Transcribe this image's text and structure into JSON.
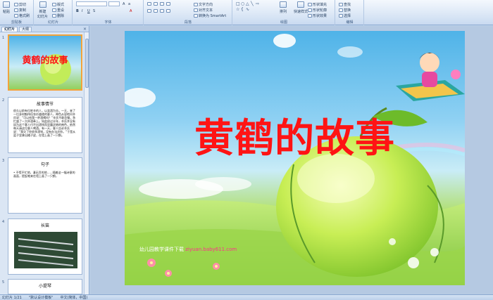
{
  "ribbon": {
    "groups": [
      "剪贴板",
      "幻灯片",
      "字体",
      "段落",
      "绘图",
      "编辑"
    ],
    "paste": "粘贴",
    "cut": "剪切",
    "copy": "复制",
    "format_painter": "格式刷",
    "new_slide": "新建\n幻灯片",
    "layout": "版式",
    "reset": "重设",
    "delete": "删除",
    "text_direction": "文字方向",
    "align_text": "对齐文本",
    "convert_smartart": "转换为 SmartArt",
    "arrange": "排列",
    "quick_styles": "快速样式",
    "shape_fill": "形状填充",
    "shape_outline": "形状轮廓",
    "shape_effects": "形状效果",
    "find": "查找",
    "replace": "替换",
    "select": "选择"
  },
  "panel": {
    "tabs": [
      "幻灯片",
      "大纲"
    ],
    "close": "×",
    "thumbnails": [
      {
        "num": "1",
        "title": "黄鹤的故事"
      },
      {
        "num": "2",
        "title": "故事情节",
        "text": "很久以前有位姓辛的人，以卖酒为业。一天，来了一位身材魁伟但衣衫褴褛的客人，神色从容地问辛氏说：“可以给我一杯酒喝吗？”辛氏不敢怠慢，急忙盛了一大杯酒奉上。如此经过半年，辛氏并没有因为这个客人付不出酒钱而显露厌倦的神色，依然每天请这位客人喝酒。有一天，客人告诉辛氏说：“我欠了你很多酒钱，没有办法还你。”于是从篮子里拿出橘子皮，在墙上画了一只鹤。"
      },
      {
        "num": "3",
        "title": "句子",
        "text": "• 不慌不忙地，漫无目的地……随着这一幅诗意的画面，提起笔来在墙上画了一只鹤，"
      },
      {
        "num": "4",
        "title": "长笛"
      },
      {
        "num": "5",
        "title": "小提琴"
      }
    ]
  },
  "slide": {
    "title": "黄鹤的故事",
    "footer_text": "幼儿园教学课件下载",
    "footer_url": "ziyuan.baby611.com"
  },
  "status": {
    "slide_counter": "幻灯片 1/21",
    "theme": "\"默认设计模板\"",
    "language": "中文(简体，中国)"
  },
  "colors": {
    "title_red": "#ff1414",
    "selection_orange": "#f2a33a",
    "footer_url_pink": "#ff2f8a"
  }
}
